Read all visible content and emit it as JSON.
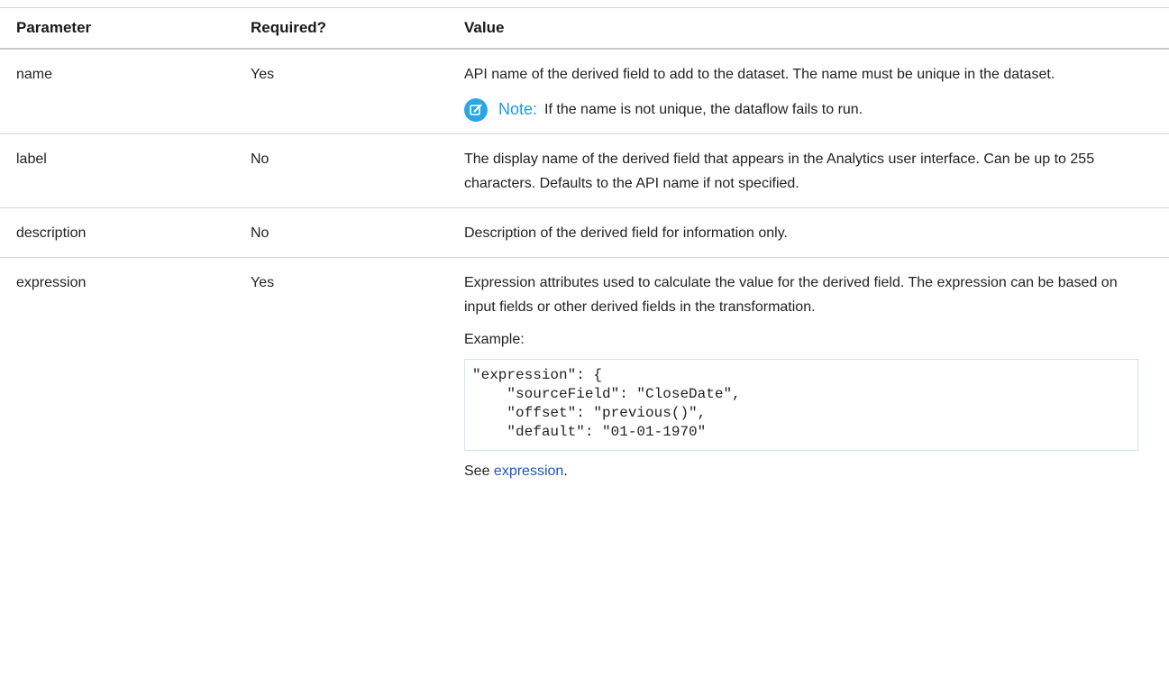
{
  "table": {
    "headers": [
      "Parameter",
      "Required?",
      "Value"
    ],
    "rows": [
      {
        "parameter": "name",
        "required": "Yes",
        "value": "API name of the derived field to add to the dataset. The name must be unique in the dataset.",
        "note_label": "Note:",
        "note_text": "If the name is not unique, the dataflow fails to run."
      },
      {
        "parameter": "label",
        "required": "No",
        "value": "The display name of the derived field that appears in the Analytics user interface. Can be up to 255 characters. Defaults to the API name if not specified."
      },
      {
        "parameter": "description",
        "required": "No",
        "value": "Description of the derived field for information only."
      },
      {
        "parameter": "expression",
        "required": "Yes",
        "value": "Expression attributes used to calculate the value for the derived field. The expression can be based on input fields or other derived fields in the transformation.",
        "example_label": "Example:",
        "code": "\"expression\": {\n    \"sourceField\": \"CloseDate\",\n    \"offset\": \"previous()\",\n    \"default\": \"01-01-1970\"",
        "see_prefix": "See ",
        "see_link": "expression",
        "see_suffix": "."
      }
    ]
  },
  "colors": {
    "note_icon": "#2aa6e6",
    "note_label": "#1a9be0",
    "link": "#1f55c8"
  }
}
